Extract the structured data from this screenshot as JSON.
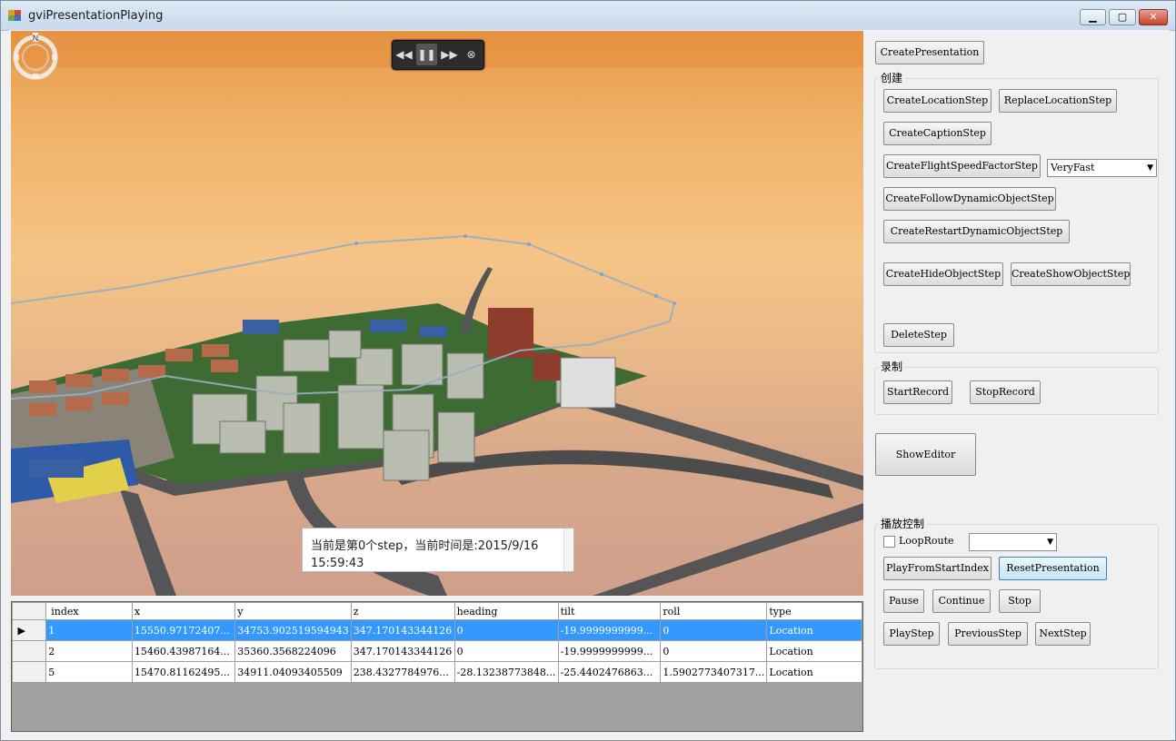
{
  "window": {
    "title": "gviPresentationPlaying",
    "minimize": "▁",
    "maximize": "▢",
    "close": "✕"
  },
  "view": {
    "caption": "当前是第0个step，当前时间是:2015/9/16 15:59:43",
    "controls": [
      "rewind-icon",
      "pause-icon",
      "fast-forward-icon",
      "stop-icon"
    ],
    "compass_letter": "N"
  },
  "panel": {
    "create_presentation": "CreatePresentation",
    "create_group": {
      "label": "创建",
      "create_location": "CreateLocationStep",
      "replace_location": "ReplaceLocationStep",
      "create_caption": "CreateCaptionStep",
      "create_flight_speed": "CreateFlightSpeedFactorStep",
      "speed_value": "VeryFast",
      "create_follow": "CreateFollowDynamicObjectStep",
      "create_restart": "CreateRestartDynamicObjectStep",
      "create_hide": "CreateHideObjectStep",
      "create_show": "CreateShowObjectStep",
      "delete_step": "DeleteStep"
    },
    "record_group": {
      "label": "录制",
      "start": "StartRecord",
      "stop": "StopRecord"
    },
    "show_editor": "ShowEditor",
    "play_group": {
      "label": "播放控制",
      "loop_route": "LoopRoute",
      "loop_checked": false,
      "route_value": "",
      "play_from_start": "PlayFromStartIndex",
      "reset": "ResetPresentation",
      "pause": "Pause",
      "continue": "Continue",
      "stop": "Stop",
      "play_step": "PlayStep",
      "previous_step": "PreviousStep",
      "next_step": "NextStep"
    }
  },
  "grid": {
    "columns": [
      "index",
      "x",
      "y",
      "z",
      "heading",
      "tilt",
      "roll",
      "type"
    ],
    "rows": [
      [
        "1",
        "15550.97172407...",
        "34753.902519594943",
        "347.170143344126",
        "0",
        "-19.9999999999...",
        "0",
        "Location"
      ],
      [
        "2",
        "15460.43987164...",
        "35360.3568224096",
        "347.170143344126",
        "0",
        "-19.9999999999...",
        "0",
        "Location"
      ],
      [
        "5",
        "15470.81162495...",
        "34911.04093405509",
        "238.4327784976...",
        "-28.13238773848...",
        "-25.4402476863...",
        "1.5902773407317...",
        "Location"
      ]
    ],
    "selected_row": 0
  },
  "colors": {
    "selection": "#3399ff",
    "sky_top": "#e79a4a",
    "sky_bottom": "#cf9f8c"
  }
}
